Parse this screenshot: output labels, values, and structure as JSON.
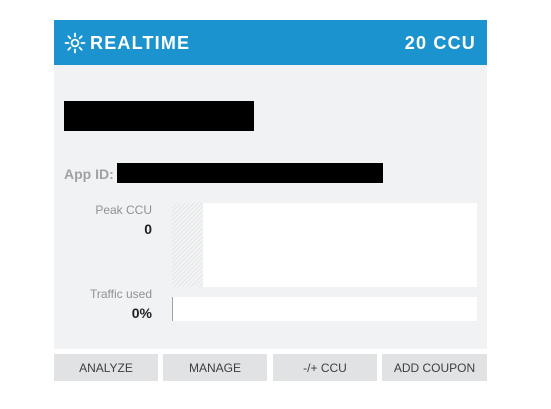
{
  "header": {
    "icon": "realtime-sun-icon",
    "title": "REALTIME",
    "ccu": "20 CCU",
    "color": "#1b93cf"
  },
  "app": {
    "id_label": "App ID:"
  },
  "metrics": {
    "peak_ccu": {
      "label": "Peak CCU",
      "value": "0",
      "fill_fraction": 0.1
    },
    "traffic": {
      "label": "Traffic used",
      "value": "0%",
      "fill_fraction": 0.0
    }
  },
  "actions": [
    {
      "label": "ANALYZE"
    },
    {
      "label": "MANAGE"
    },
    {
      "label": "-/+ CCU"
    },
    {
      "label": "ADD COUPON"
    }
  ]
}
